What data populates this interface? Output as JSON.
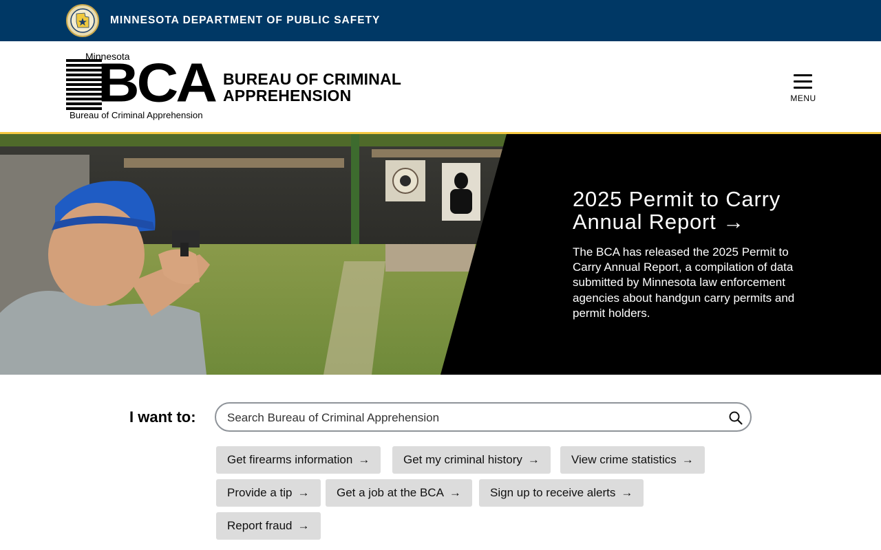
{
  "agency_bar": {
    "title": "MINNESOTA DEPARTMENT OF PUBLIC SAFETY"
  },
  "logo": {
    "state": "Minnesota",
    "letters": "BCA",
    "subtitle": "Bureau of Criminal Apprehension"
  },
  "header": {
    "site_title": "BUREAU OF CRIMINAL APPREHENSION",
    "menu_label": "MENU"
  },
  "hero": {
    "heading": "2025 Permit to Carry Annual Report",
    "arrow": "→",
    "text": "The BCA has released the 2025 Permit to Carry Annual Report, a compilation of data submitted by Minnesota law enforcement agencies about handgun carry permits and permit holders."
  },
  "iwant": {
    "label": "I want to:",
    "search_placeholder": "Search Bureau of Criminal Apprehension",
    "links": [
      {
        "label": "Get firearms information",
        "arrow": "→"
      },
      {
        "label": "Get my criminal history",
        "arrow": "→"
      },
      {
        "label": "View crime statistics",
        "arrow": "→"
      },
      {
        "label": "Provide a tip",
        "arrow": "→"
      },
      {
        "label": "Get a job at the BCA",
        "arrow": "→"
      },
      {
        "label": "Sign up to receive alerts",
        "arrow": "→"
      },
      {
        "label": "Report fraud",
        "arrow": "→"
      }
    ]
  },
  "colors": {
    "agency_blue": "#003865",
    "accent_gold": "#f5c842",
    "button_gray": "#dcdcdc"
  }
}
